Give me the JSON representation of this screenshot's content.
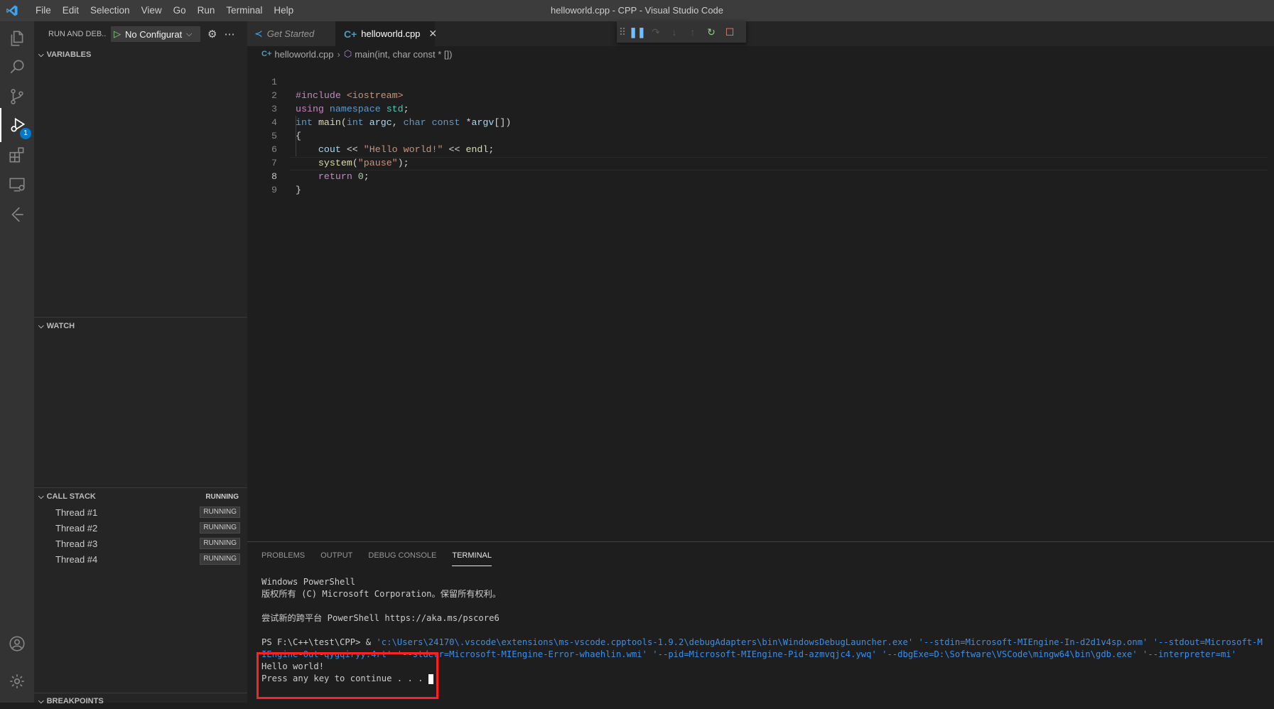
{
  "window": {
    "title": "helloworld.cpp - CPP - Visual Studio Code",
    "menu": [
      "File",
      "Edit",
      "Selection",
      "View",
      "Go",
      "Run",
      "Terminal",
      "Help"
    ]
  },
  "activity_bar": {
    "items": [
      "explorer-icon",
      "search-icon",
      "source-control-icon",
      "run-debug-icon",
      "extensions-icon",
      "remote-explorer-icon",
      "live-share-icon",
      "accounts-icon",
      "manage-icon"
    ],
    "debug_badge": "1"
  },
  "sidebar": {
    "header": "RUN AND DEB...",
    "config": "No Configurat",
    "sections": {
      "variables": "VARIABLES",
      "watch": "WATCH",
      "call_stack": "CALL STACK",
      "call_stack_status": "RUNNING",
      "breakpoints": "BREAKPOINTS"
    },
    "threads": [
      {
        "name": "Thread #1",
        "status": "RUNNING"
      },
      {
        "name": "Thread #2",
        "status": "RUNNING"
      },
      {
        "name": "Thread #3",
        "status": "RUNNING"
      },
      {
        "name": "Thread #4",
        "status": "RUNNING"
      }
    ]
  },
  "tabs": [
    {
      "label": "Get Started",
      "active": false
    },
    {
      "label": "helloworld.cpp",
      "active": true
    }
  ],
  "breadcrumb": {
    "file": "helloworld.cpp",
    "symbol": "main(int, char const * [])"
  },
  "editor": {
    "line_numbers": [
      "1",
      "2",
      "3",
      "4",
      "5",
      "6",
      "7",
      "8",
      "9"
    ],
    "current_line": "8",
    "lines": [
      "#include <iostream>",
      "using namespace std;",
      "int main(int argc, char const *argv[])",
      "{",
      "    cout << \"Hello world!\" << endl;",
      "    system(\"pause\");",
      "    return 0;",
      "}",
      ""
    ]
  },
  "panel": {
    "tabs": [
      "PROBLEMS",
      "OUTPUT",
      "DEBUG CONSOLE",
      "TERMINAL"
    ],
    "active_tab": "TERMINAL",
    "terminal": {
      "line1": "Windows PowerShell",
      "line2": "版权所有 (C) Microsoft Corporation。保留所有权利。",
      "line3": "尝试新的跨平台 PowerShell https://aka.ms/pscore6",
      "prompt": "PS F:\\C++\\test\\CPP>  & ",
      "command": "'c:\\Users\\24170\\.vscode\\extensions\\ms-vscode.cpptools-1.9.2\\debugAdapters\\bin\\WindowsDebugLauncher.exe' '--stdin=Microsoft-MIEngine-In-d2d1v4sp.onm' '--stdout=Microsoft-MIEngine-Out-qygqiryy.4rt' '--stderr=Microsoft-MIEngine-Error-whaehlin.wmi' '--pid=Microsoft-MIEngine-Pid-azmvqjc4.ywq' '--dbgExe=D:\\Software\\VSCode\\mingw64\\bin\\gdb.exe' '--interpreter=mi'",
      "output1": "Hello world!",
      "output2": "Press any key to continue . . . "
    }
  },
  "colors": {
    "highlight_box": "#ff2020",
    "accent": "#007acc"
  }
}
